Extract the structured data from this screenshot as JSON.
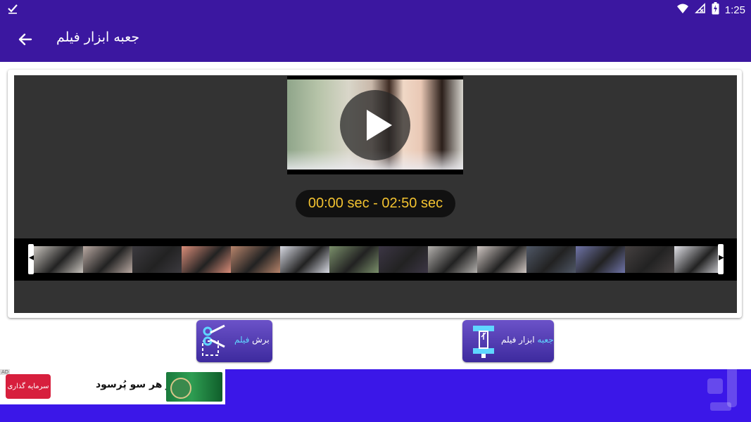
{
  "status_bar": {
    "time": "1:25",
    "icons": [
      "done-all-icon",
      "wifi-icon",
      "no-signal-icon",
      "battery-charging-icon"
    ]
  },
  "app_bar": {
    "title": "جعبه ابزار فیلم",
    "back_icon": "arrow-back-icon"
  },
  "player": {
    "time_range": "00:00 sec - 02:50 sec",
    "play_icon": "play-icon",
    "thumbnail_colors": [
      "#c8c3bd",
      "#b9a9a2",
      "#3c3a3f",
      "#d98c78",
      "#b7846b",
      "#d7d9e2",
      "#7a8f6a",
      "#3c3645",
      "#b3b0ad",
      "#cfc6c2",
      "#4f5766",
      "#6f74a8",
      "#454040",
      "#e0e0e6"
    ]
  },
  "actions": {
    "toolbox": {
      "label_highlight": "جعبه",
      "label_rest": " ابزار فیلم",
      "icon": "toolbox-icon"
    },
    "cut": {
      "label_rest": "برش",
      "label_highlight": " فیلم",
      "icon": "scissors-cut-icon"
    }
  },
  "ad": {
    "badge": "AD",
    "cta": "سرمایه گذاری",
    "text": "از هر سو پُرسود"
  },
  "colors": {
    "primary": "#3b17a0",
    "bottom_bar": "#3b17e8",
    "time_text": "#f2c230",
    "ad_cta": "#d71f3d"
  }
}
